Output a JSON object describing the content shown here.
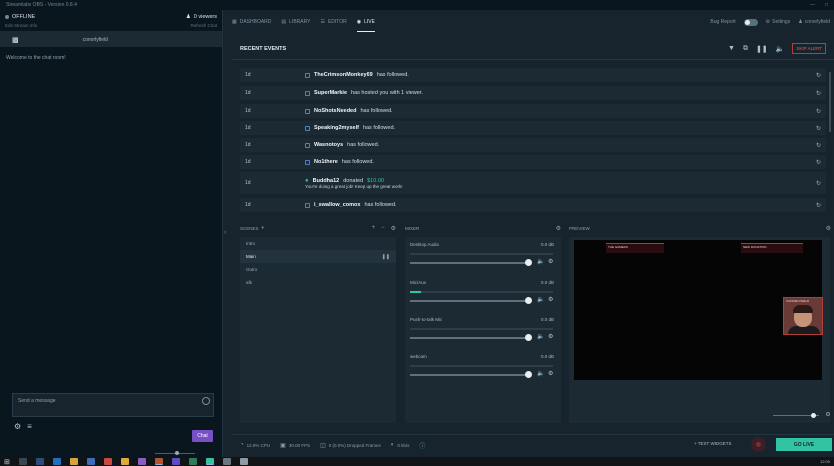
{
  "titlebar": {
    "title": "Streamlabs OBS - Version 0.8.4",
    "controls": [
      "—",
      "□"
    ]
  },
  "chat": {
    "status": "OFFLINE",
    "viewers": "0 viewers",
    "edit_stream_info": "Edit Stream Info",
    "refresh_chat": "Refresh Chat",
    "username": "conorlyfield",
    "welcome": "Welcome to the chat room!",
    "input_placeholder": "Send a message",
    "send_label": "Chat"
  },
  "nav": {
    "tabs": [
      {
        "label": "DASHBOARD",
        "icon": "dashboard-icon"
      },
      {
        "label": "LIBRARY",
        "icon": "library-icon"
      },
      {
        "label": "EDITOR",
        "icon": "editor-icon"
      },
      {
        "label": "LIVE",
        "icon": "live-icon",
        "active": true
      }
    ],
    "bug_report": "Bug Report",
    "settings": "Settings",
    "account": "conorlyfield"
  },
  "recent_events": {
    "title": "RECENT EVENTS",
    "alert_button": "SKIP ALERT",
    "events": [
      {
        "age": "1d",
        "user": "TheCrimsonMonkey69",
        "text": "has followed."
      },
      {
        "age": "1d",
        "user": "SuperMarkie",
        "text": "has hosted you with 1 viewer."
      },
      {
        "age": "1d",
        "user": "NoShotsNeeded",
        "text": "has followed."
      },
      {
        "age": "1d",
        "user": "Speaking2myself",
        "text": "has followed."
      },
      {
        "age": "1d",
        "user": "Wasnotoys",
        "text": "has followed."
      },
      {
        "age": "1d",
        "user": "No1there",
        "text": "has followed."
      },
      {
        "age": "1d",
        "user": "Buddha12",
        "text": "donated",
        "amount": "$10.00",
        "sub": "You're doing a great job! Keep up the great work!"
      },
      {
        "age": "1d",
        "user": "i_swallow_comox",
        "text": "has followed."
      }
    ]
  },
  "scenes": {
    "title": "SCENES",
    "items": [
      "Intro",
      "Main",
      "Outro",
      "afk"
    ],
    "selected": 1
  },
  "mixer": {
    "title": "MIXER",
    "channels": [
      {
        "name": "Desktop Audio",
        "db": "0.0 dB",
        "level": 0.0
      },
      {
        "name": "Mic/Aux",
        "db": "0.0 dB",
        "level": 0.08
      },
      {
        "name": "Push-to-talk Mic",
        "db": "0.0 dB",
        "level": 0.0
      },
      {
        "name": "webcam",
        "db": "0.0 dB",
        "level": 0.0
      }
    ]
  },
  "preview": {
    "title": "PREVIEW",
    "overlay_left": "THE GAMERS",
    "overlay_right": "NEW DONATION",
    "cam_tag": "CONORLYFIELD"
  },
  "footer": {
    "cpu": "12.8% CPU",
    "fps": "30.00 FPS",
    "dropped": "0 (0.0%) Dropped Frames",
    "bitrate": "0 kb/s",
    "test_widgets": "TEST WIDGETS",
    "go_live": "GO LIVE"
  },
  "taskbar": {
    "clock": "12:00"
  },
  "colors": {
    "accent": "#31c3a2",
    "chat_button": "#7750c4",
    "alert": "#e85a5a",
    "link_icon": "#4f7fd1"
  }
}
